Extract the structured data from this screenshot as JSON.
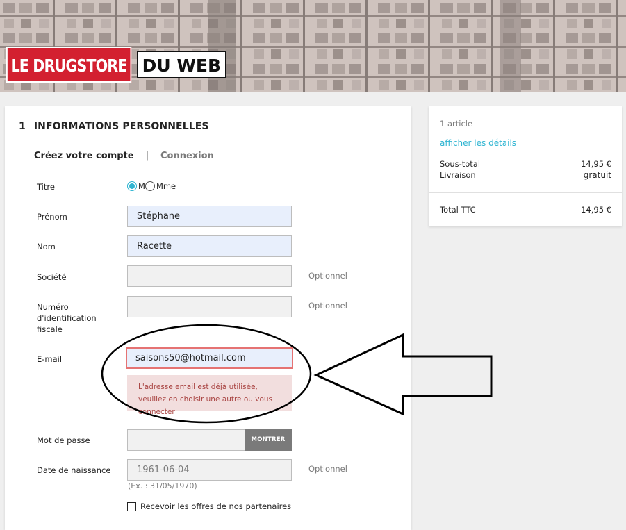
{
  "header": {
    "logo_left": "LE DRUGSTORE",
    "logo_right": "DU WEB"
  },
  "form": {
    "step_number": "1",
    "step_title": "INFORMATIONS PERSONNELLES",
    "tab_create": "Créez votre compte",
    "tab_separator": "|",
    "tab_login": "Connexion",
    "title_label": "Titre",
    "title_options": [
      "M",
      "Mme"
    ],
    "title_selected": "M",
    "firstname_label": "Prénom",
    "firstname_value": "Stéphane",
    "lastname_label": "Nom",
    "lastname_value": "Racette",
    "company_label": "Société",
    "company_value": "",
    "optional": "Optionnel",
    "taxid_label": "Numéro d'identification fiscale",
    "taxid_value": "",
    "email_label": "E-mail",
    "email_value": "saisons50@hotmail.com",
    "email_error": "L'adresse email est déjà utilisée, veuillez en choisir une autre ou vous connecter",
    "password_label": "Mot de passe",
    "password_value": "",
    "show_button": "MONTRER",
    "birthdate_label": "Date de naissance",
    "birthdate_value": "1961-06-04",
    "birthdate_hint": "(Ex. : 31/05/1970)",
    "partners_checkbox_label": "Recevoir les offres de nos partenaires",
    "partners_checked": false
  },
  "summary": {
    "item_count": "1 article",
    "details_link": "afficher les détails",
    "subtotal_label": "Sous-total",
    "subtotal_value": "14,95 €",
    "shipping_label": "Livraison",
    "shipping_value": "gratuit",
    "total_label": "Total TTC",
    "total_value": "14,95 €"
  },
  "colors": {
    "accent": "#2fb5d2",
    "error_bg": "#f2dede",
    "error_text": "#a94442",
    "logo_red": "#d32030"
  }
}
